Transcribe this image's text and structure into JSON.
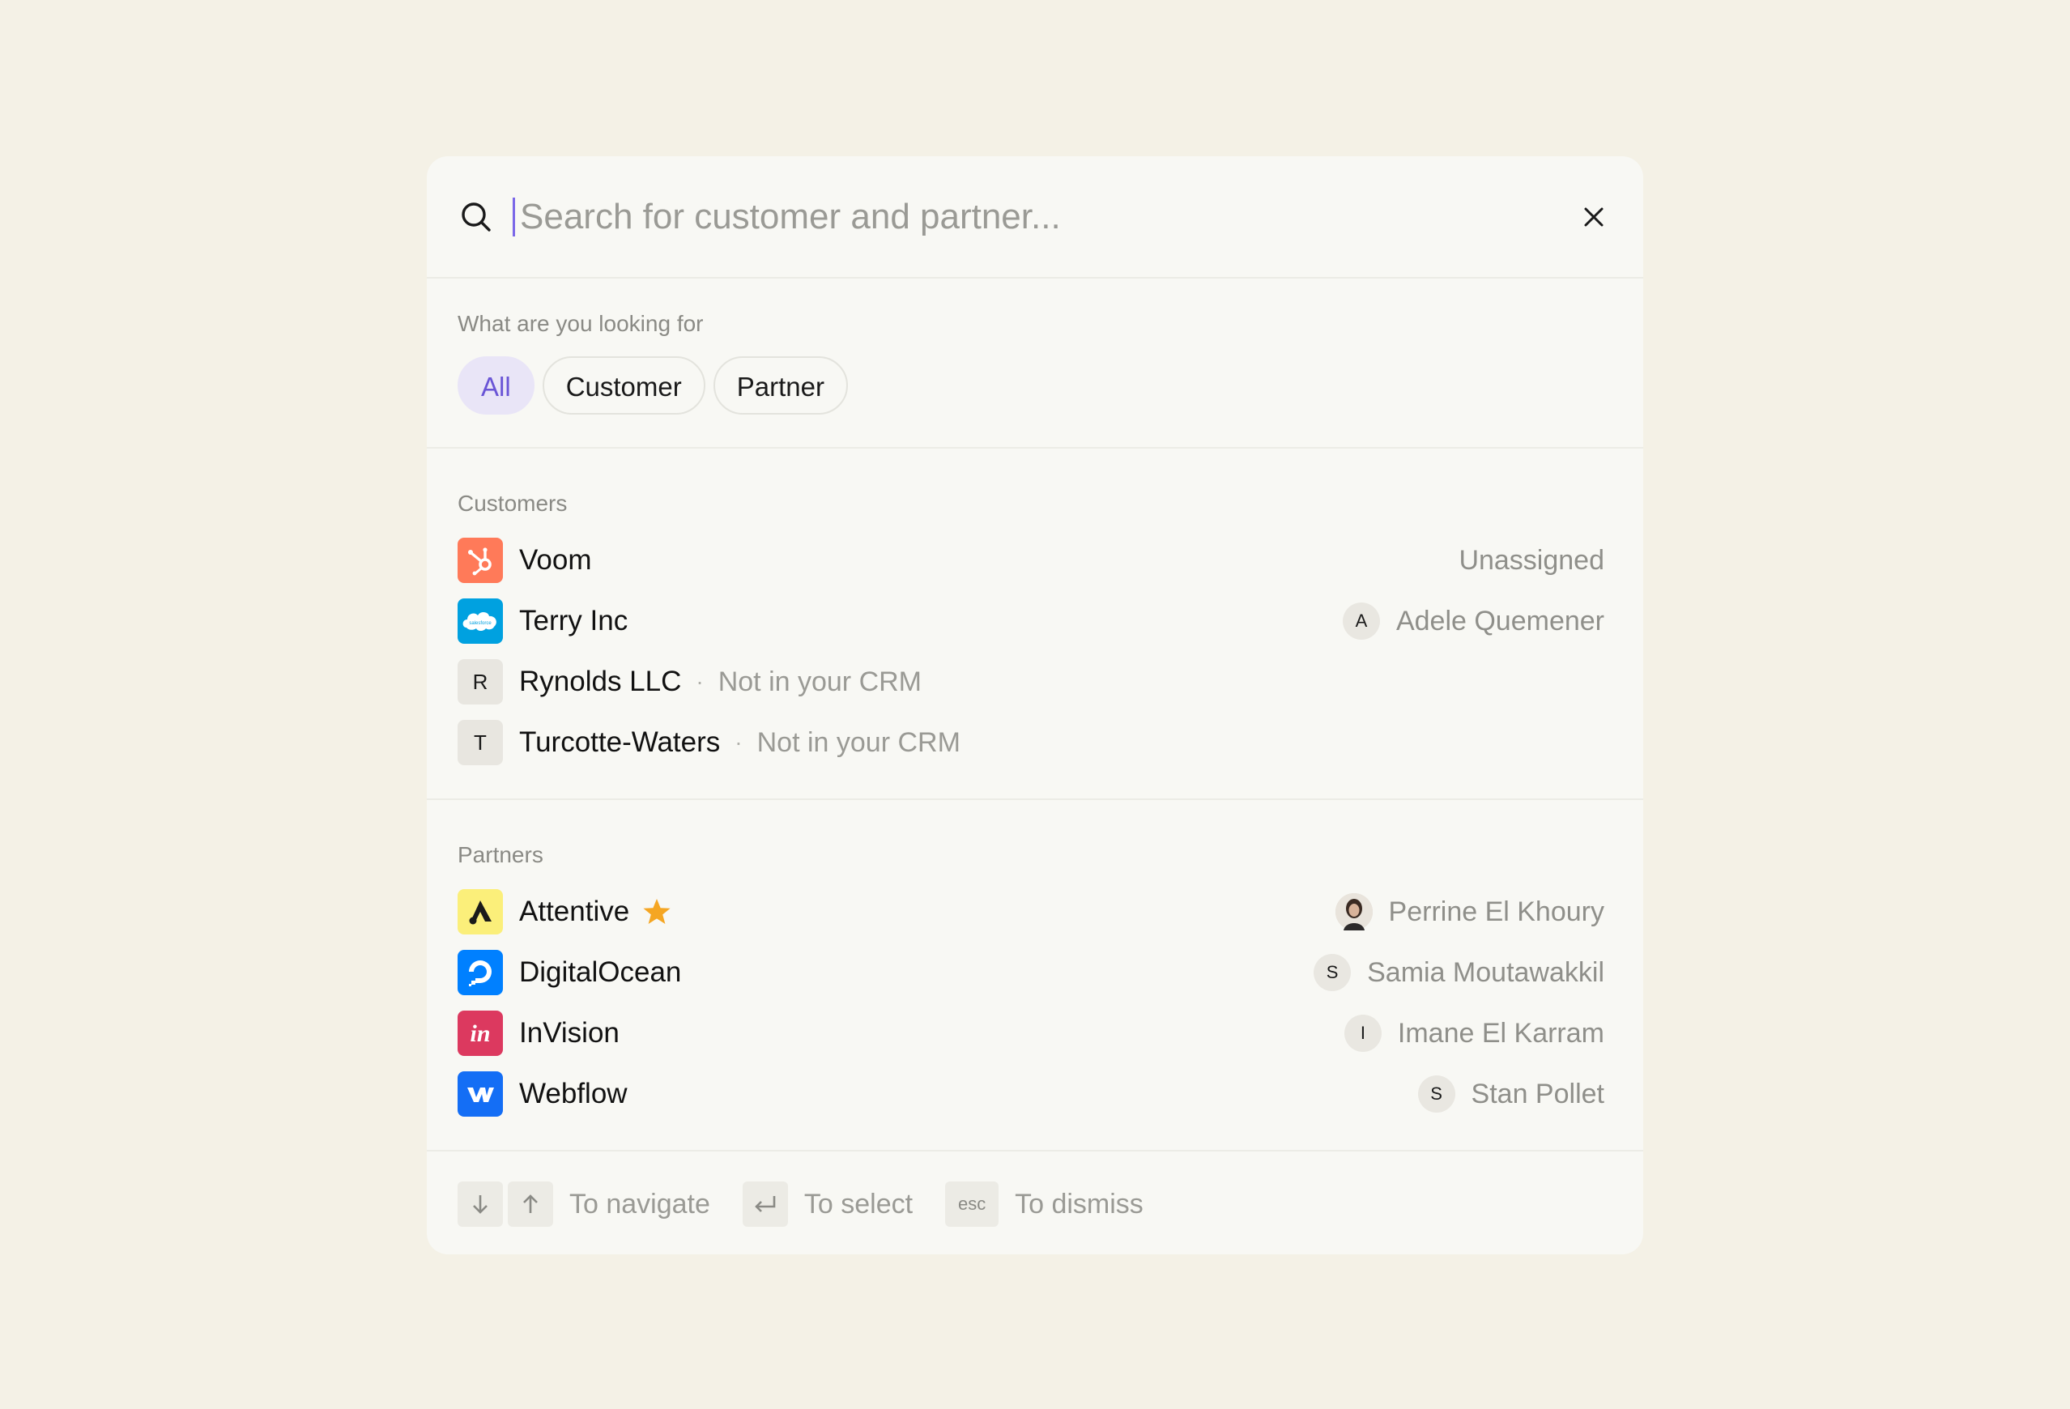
{
  "search": {
    "placeholder": "Search for customer and partner...",
    "value": ""
  },
  "filter": {
    "label": "What are you looking for",
    "chips": [
      {
        "label": "All",
        "active": true
      },
      {
        "label": "Customer",
        "active": false
      },
      {
        "label": "Partner",
        "active": false
      }
    ]
  },
  "customers": {
    "label": "Customers",
    "items": [
      {
        "name": "Voom",
        "logo": "hubspot-icon",
        "logo_color": "#ff7a59",
        "owner": "Unassigned"
      },
      {
        "name": "Terry Inc",
        "logo": "salesforce-icon",
        "logo_color": "#00a1e0",
        "logo_text": "salesforce",
        "owner": "Adele Quemener",
        "owner_initial": "A"
      },
      {
        "name": "Rynolds LLC",
        "logo_letter": "R",
        "status": "Not in your CRM"
      },
      {
        "name": "Turcotte-Waters",
        "logo_letter": "T",
        "status": "Not in your CRM"
      }
    ]
  },
  "partners": {
    "label": "Partners",
    "items": [
      {
        "name": "Attentive",
        "logo": "attentive-icon",
        "logo_color": "#fbef7a",
        "starred": true,
        "owner": "Perrine El Khoury"
      },
      {
        "name": "DigitalOcean",
        "logo": "digitalocean-icon",
        "logo_color": "#0080ff",
        "owner": "Samia Moutawakkil",
        "owner_initial": "S"
      },
      {
        "name": "InVision",
        "logo": "invision-icon",
        "logo_color": "#dc395f",
        "logo_text": "in",
        "owner": "Imane El Karram",
        "owner_initial": "I"
      },
      {
        "name": "Webflow",
        "logo": "webflow-icon",
        "logo_color": "#146ef5",
        "owner": "Stan Pollet",
        "owner_initial": "S"
      }
    ]
  },
  "footer": {
    "navigate": "To navigate",
    "select": "To select",
    "esc_key": "esc",
    "dismiss": "To dismiss"
  },
  "colors": {
    "accent": "#6a55d6",
    "star": "#f5a623"
  }
}
